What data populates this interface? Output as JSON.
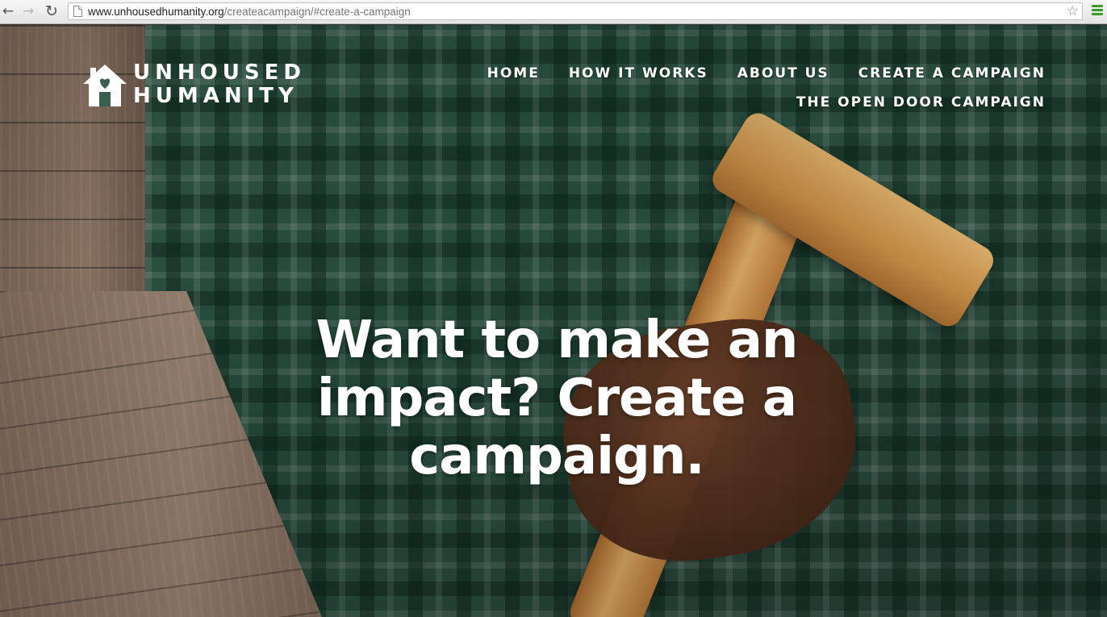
{
  "browser": {
    "url_host": "www.unhousedhumanity.org",
    "url_path": "/createacampaign/#create-a-campaign"
  },
  "logo": {
    "line1": "UNHOUSED",
    "line2": "HUMANITY"
  },
  "nav": {
    "home": "HOME",
    "how_it_works": "HOW IT WORKS",
    "about_us": "ABOUT US",
    "create_a_campaign": "CREATE A CAMPAIGN",
    "open_door": "THE OPEN DOOR CAMPAIGN"
  },
  "hero": {
    "headline": "Want to make an impact? Create a campaign."
  },
  "colors": {
    "menu_accent": "#3a9d23",
    "text": "#ffffff"
  }
}
